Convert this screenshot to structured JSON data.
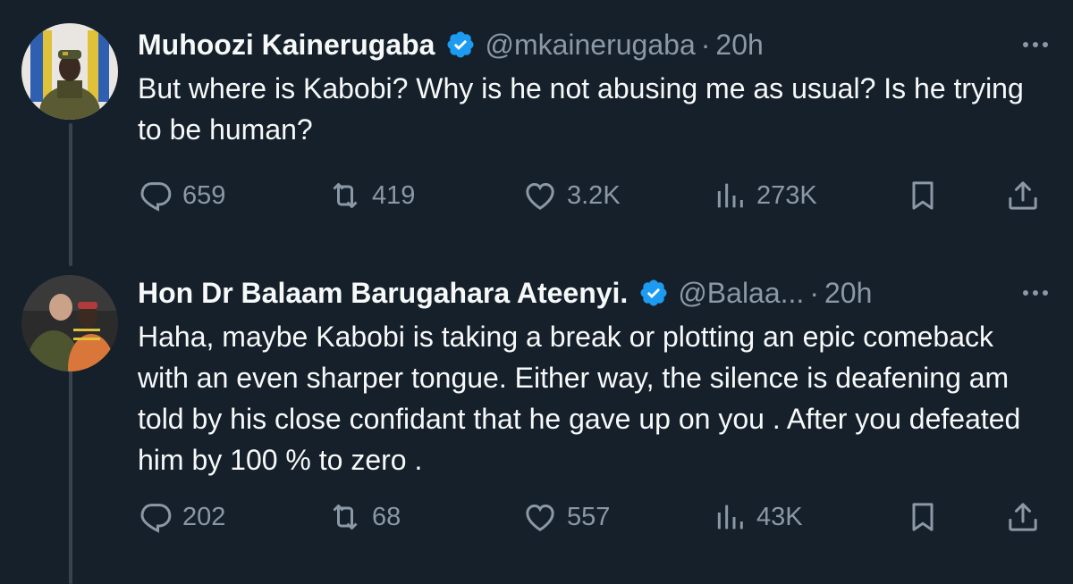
{
  "tweets": [
    {
      "name": "Muhoozi Kainerugaba",
      "handle": "@mkainerugaba",
      "separator": "·",
      "time": "20h",
      "text": "But where is Kabobi? Why is he not abusing me as usual? Is he trying to be human?",
      "replies": "659",
      "reposts": "419",
      "likes": "3.2K",
      "views": "273K",
      "avatar_colors": {
        "bg": "#e9e6e1",
        "uniform": "#5b5b33",
        "flag_blue": "#2f5fb0",
        "flag_yellow": "#e0c23a",
        "skin": "#3b2a22"
      }
    },
    {
      "name": "Hon Dr Balaam Barugahara Ateenyi.",
      "handle": "@Balaa...",
      "separator": "·",
      "time": "20h",
      "text": "Haha, maybe Kabobi is taking a break or plotting an epic comeback with an even sharper tongue. Either way, the silence is deafening am told by his close confidant that he gave up on you . After you defeated him by 100 % to zero .",
      "replies": "202",
      "reposts": "68",
      "likes": "557",
      "views": "43K",
      "avatar_colors": {
        "bg": "#2b2b2b",
        "uniform": "#4d5530",
        "shirt": "#d9773a",
        "skin": "#caa189"
      }
    }
  ],
  "colors": {
    "background": "#15202b",
    "text": "#f7f9f9",
    "muted": "#8b98a5",
    "verified": "#1d9bf0",
    "thread_line": "#38444d"
  },
  "icons": {
    "more": "more-horizontal-icon",
    "verified": "verified-badge-icon",
    "reply": "reply-icon",
    "repost": "repost-icon",
    "like": "heart-icon",
    "views": "views-chart-icon",
    "bookmark": "bookmark-icon",
    "share": "share-icon"
  }
}
